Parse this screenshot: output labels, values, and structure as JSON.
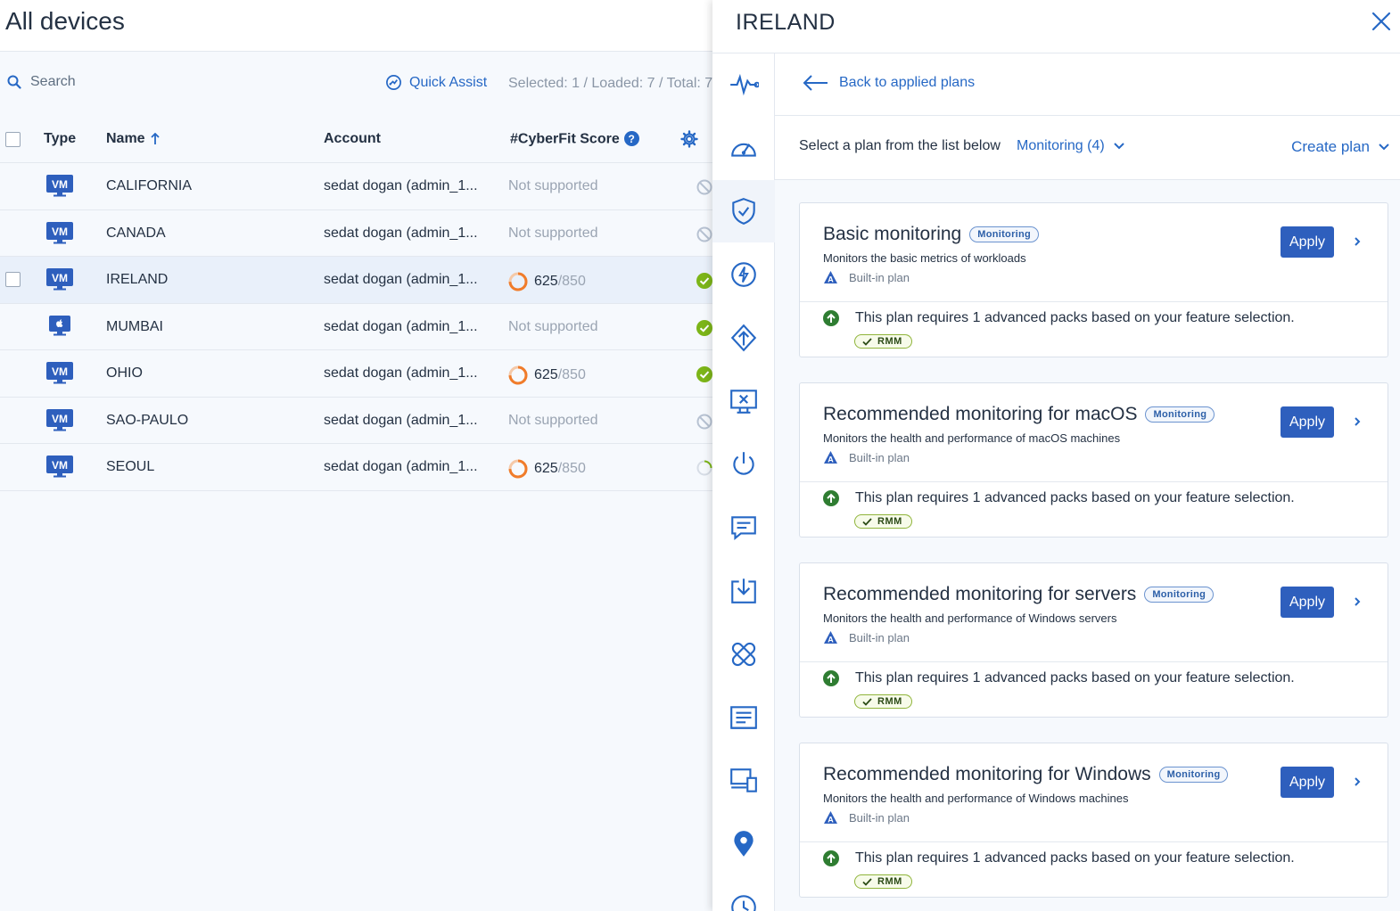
{
  "devices": {
    "title": "All devices",
    "search_placeholder": "Search",
    "quick_assist": "Quick Assist",
    "counts": "Selected: 1 / Loaded: 7 / Total: 7",
    "columns": {
      "type": "Type",
      "name": "Name",
      "account": "Account",
      "score": "#CyberFit Score"
    },
    "rows": [
      {
        "type": "VM",
        "name": "CALIFORNIA",
        "account": "sedat dogan (admin_1...",
        "score_text": "Not supported",
        "status": "unsupported"
      },
      {
        "type": "VM",
        "name": "CANADA",
        "account": "sedat dogan (admin_1...",
        "score_text": "Not supported",
        "status": "unsupported"
      },
      {
        "type": "VM",
        "name": "IRELAND",
        "account": "sedat dogan (admin_1...",
        "score": "625",
        "score_max": "/850",
        "status": "ok",
        "selected": true
      },
      {
        "type": "mac",
        "name": "MUMBAI",
        "account": "sedat dogan (admin_1...",
        "score_text": "Not supported",
        "status": "ok"
      },
      {
        "type": "VM",
        "name": "OHIO",
        "account": "sedat dogan (admin_1...",
        "score": "625",
        "score_max": "/850",
        "status": "ok"
      },
      {
        "type": "VM",
        "name": "SAO-PAULO",
        "account": "sedat dogan (admin_1...",
        "score_text": "Not supported",
        "status": "unsupported"
      },
      {
        "type": "VM",
        "name": "SEOUL",
        "account": "sedat dogan (admin_1...",
        "score": "625",
        "score_max": "/850",
        "status": "loading"
      }
    ]
  },
  "drawer": {
    "title": "IRELAND",
    "back_label": "Back to applied plans",
    "select_label": "Select a plan from the list below",
    "plan_filter": "Monitoring (4)",
    "create_plan": "Create plan",
    "rail_icons": [
      "activity-icon",
      "dashboard-icon",
      "protection-shield-icon",
      "lightning-icon",
      "patch-icon",
      "remote-desktop-icon",
      "power-icon",
      "chat-icon",
      "download-icon",
      "bandage-icon",
      "inventory-icon",
      "devices-icon",
      "location-pin-icon",
      "history-clock-icon"
    ],
    "plans": [
      {
        "title": "Basic monitoring",
        "tag": "Monitoring",
        "desc": "Monitors the basic metrics of workloads",
        "builtin": "Built-in plan",
        "apply": "Apply",
        "requirement": "This plan requires 1 advanced packs based on your feature selection.",
        "pack": "RMM"
      },
      {
        "title": "Recommended monitoring for macOS",
        "tag": "Monitoring",
        "desc": "Monitors the health and performance of macOS machines",
        "builtin": "Built-in plan",
        "apply": "Apply",
        "requirement": "This plan requires 1 advanced packs based on your feature selection.",
        "pack": "RMM"
      },
      {
        "title": "Recommended monitoring for servers",
        "tag": "Monitoring",
        "desc": "Monitors the health and performance of Windows servers",
        "builtin": "Built-in plan",
        "apply": "Apply",
        "requirement": "This plan requires 1 advanced packs based on your feature selection.",
        "pack": "RMM"
      },
      {
        "title": "Recommended monitoring for Windows",
        "tag": "Monitoring",
        "desc": "Monitors the health and performance of Windows machines",
        "builtin": "Built-in plan",
        "apply": "Apply",
        "requirement": "This plan requires 1 advanced packs based on your feature selection.",
        "pack": "RMM"
      }
    ]
  },
  "colors": {
    "accent": "#2668c5",
    "apply": "#2e5fbd",
    "ok": "#7cb518",
    "score_ring": "#f07c2b",
    "rmm_border": "#8fb43a"
  }
}
